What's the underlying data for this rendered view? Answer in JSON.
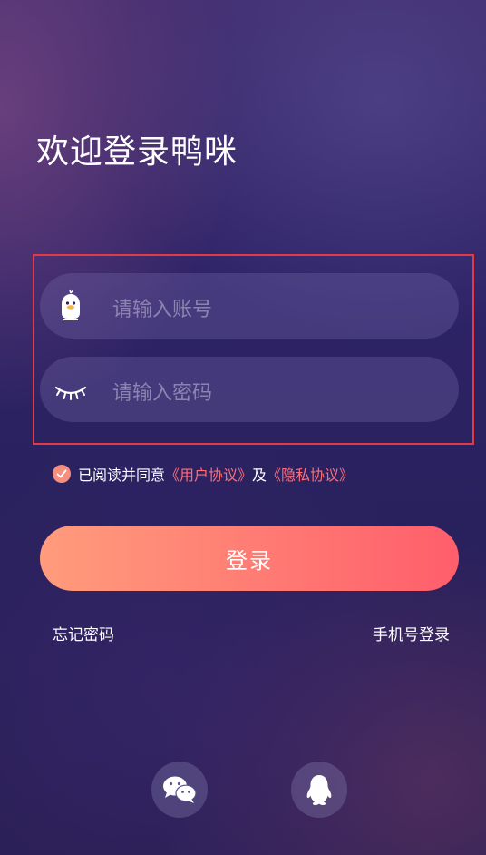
{
  "header": {
    "title": "欢迎登录鸭咪"
  },
  "form": {
    "account": {
      "placeholder": "请输入账号",
      "icon": "duck-avatar-icon"
    },
    "password": {
      "placeholder": "请输入密码",
      "icon": "closed-eye-icon"
    }
  },
  "agreement": {
    "checked": true,
    "prefix": "已阅读并同意 ",
    "user_agreement": "《用户协议》",
    "conjunction": "及",
    "privacy_policy": "《隐私协议》"
  },
  "login_button": {
    "label": "登录"
  },
  "links": {
    "forgot_password": "忘记密码",
    "phone_login": "手机号登录"
  },
  "social": [
    {
      "name": "wechat",
      "icon": "wechat-icon"
    },
    {
      "name": "qq",
      "icon": "qq-penguin-icon"
    }
  ],
  "colors": {
    "accent_start": "#ff9c7c",
    "accent_end": "#ff5e6b",
    "link": "#ff6e78",
    "highlight_border": "#e33a47"
  }
}
